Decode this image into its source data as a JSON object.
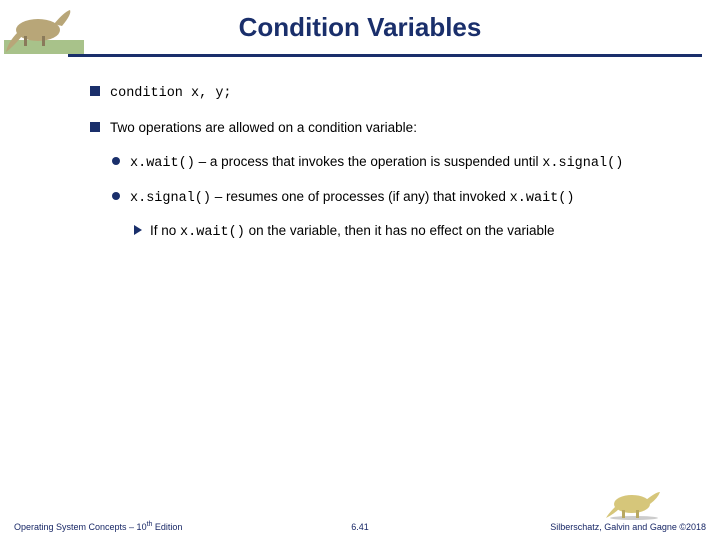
{
  "title": "Condition Variables",
  "bullets": {
    "b1a_code": "condition x, y;",
    "b1b": "Two operations are allowed on a condition variable:",
    "b2a_code": "x.wait()",
    "b2a_rest": " – a process that invokes the operation is suspended until ",
    "b2a_code2": "x.signal()",
    "b2b_code": "x.signal()",
    "b2b_rest": " – resumes one of processes (if any) that invoked ",
    "b2b_code2": "x.wait()",
    "b3_pre": "If no ",
    "b3_code": "x.wait()",
    "b3_post": " on the variable, then it has no effect on the variable"
  },
  "footer": {
    "left_a": "Operating System Concepts – 10",
    "left_sup": "th",
    "left_b": " Edition",
    "mid": "6.41",
    "right": "Silberschatz, Galvin and Gagne ©2018"
  }
}
